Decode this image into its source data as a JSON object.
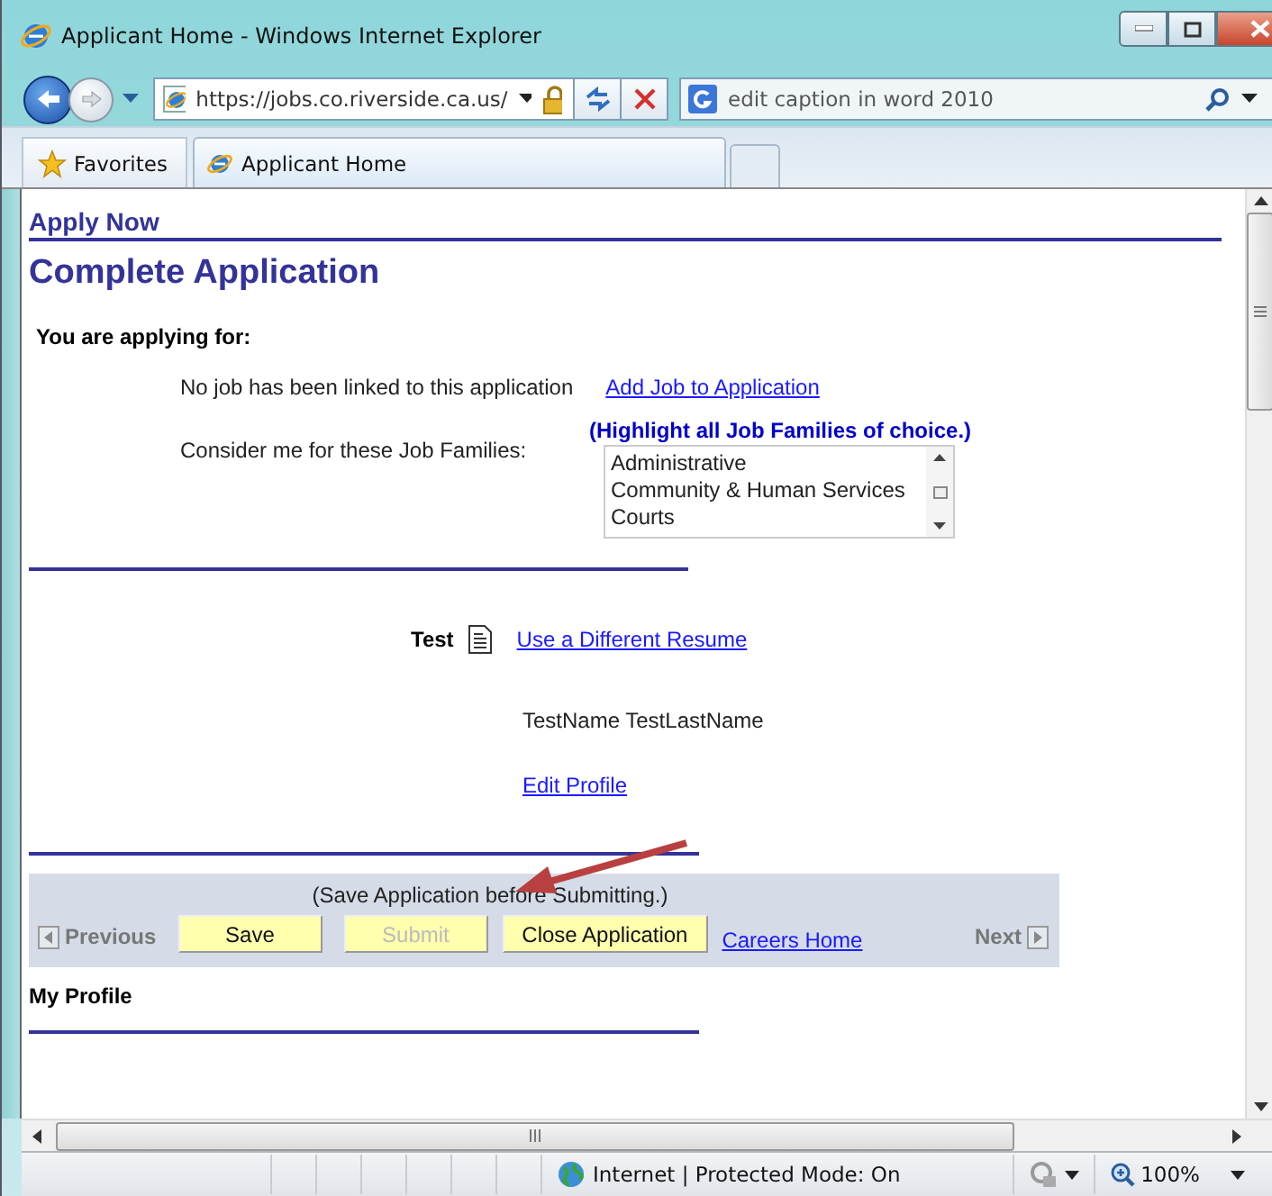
{
  "window": {
    "title": "Applicant Home - Windows Internet Explorer"
  },
  "toolbar": {
    "address": "https://jobs.co.riverside.ca.us/",
    "search": "edit caption in word 2010"
  },
  "favorites": {
    "label": "Favorites"
  },
  "tabs": [
    {
      "label": "Applicant Home",
      "selected": true
    }
  ],
  "page": {
    "breadcrumb": "Apply Now",
    "heading": "Complete Application",
    "section": "You are applying for:",
    "job_status": "No job has been linked to this application",
    "add_job_link": "Add Job to Application",
    "families_label": "Consider me for these Job Families:",
    "families_hint": "(Highlight all Job Families of choice.)",
    "families": [
      {
        "label": "Administrative",
        "selected": false
      },
      {
        "label": "Community & Human Services",
        "selected": false
      },
      {
        "label": "Courts",
        "selected": false
      }
    ],
    "resume_name": "Test",
    "resume_link": "Use a Different Resume",
    "profile_name": "TestName TestLastName",
    "edit_profile_link": "Edit Profile",
    "action_bar": {
      "note": "(Save Application before Submitting.)",
      "previous": "Previous",
      "next": "Next",
      "buttons": [
        {
          "label": "Save",
          "disabled": false
        },
        {
          "label": "Submit",
          "disabled": true
        },
        {
          "label": "Close Application",
          "disabled": false
        }
      ],
      "careers_link": "Careers Home"
    },
    "footer_section": "My Profile"
  },
  "status_bar": {
    "zone": "Internet | Protected Mode: On",
    "zoom": "100%"
  }
}
